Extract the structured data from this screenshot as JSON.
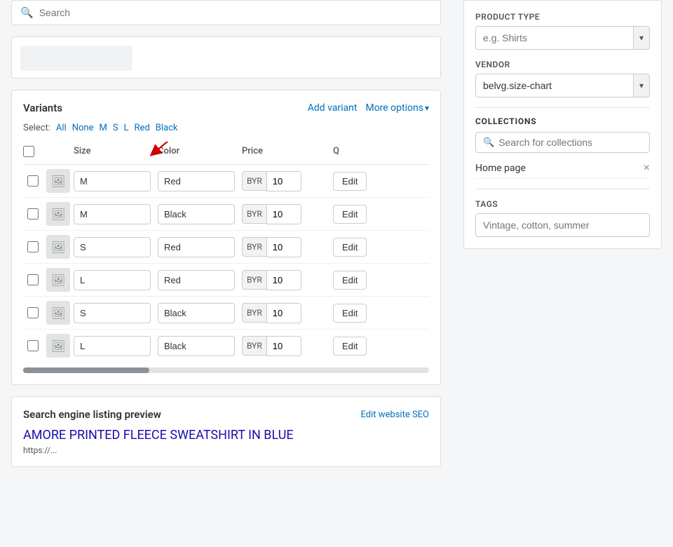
{
  "search": {
    "placeholder": "Search"
  },
  "variants": {
    "title": "Variants",
    "add_variant_label": "Add variant",
    "more_options_label": "More options",
    "select_label": "Select:",
    "select_options": [
      "All",
      "None",
      "M",
      "S",
      "L",
      "Red",
      "Black"
    ],
    "table": {
      "headers": [
        "",
        "",
        "Size",
        "Color",
        "Price",
        "Q"
      ],
      "rows": [
        {
          "id": 1,
          "size": "M",
          "color": "Red",
          "price_prefix": "BYR",
          "price": "10"
        },
        {
          "id": 2,
          "size": "M",
          "color": "Black",
          "price_prefix": "BYR",
          "price": "10"
        },
        {
          "id": 3,
          "size": "S",
          "color": "Red",
          "price_prefix": "BYR",
          "price": "10"
        },
        {
          "id": 4,
          "size": "L",
          "color": "Red",
          "price_prefix": "BYR",
          "price": "10"
        },
        {
          "id": 5,
          "size": "S",
          "color": "Black",
          "price_prefix": "BYR",
          "price": "10"
        },
        {
          "id": 6,
          "size": "L",
          "color": "Black",
          "price_prefix": "BYR",
          "price": "10"
        }
      ],
      "edit_label": "Edit"
    }
  },
  "seo": {
    "title": "Search engine listing preview",
    "edit_link": "Edit website SEO",
    "product_title": "AMORE PRINTED FLEECE SWEATSHIRT IN BLUE",
    "url": "https://..."
  },
  "sidebar": {
    "product_type": {
      "label": "PRODUCT TYPE",
      "placeholder": "e.g. Shirts"
    },
    "vendor": {
      "label": "Vendor",
      "value": "belvg.size-chart"
    },
    "collections": {
      "title": "COLLECTIONS",
      "search_placeholder": "Search for collections",
      "items": [
        {
          "name": "Home page"
        }
      ],
      "remove_icon": "×"
    },
    "tags": {
      "title": "TAGS",
      "placeholder": "Vintage, cotton, summer"
    }
  },
  "icons": {
    "search": "🔍",
    "image": "🖼",
    "chevron_down": "▾",
    "close": "×"
  }
}
